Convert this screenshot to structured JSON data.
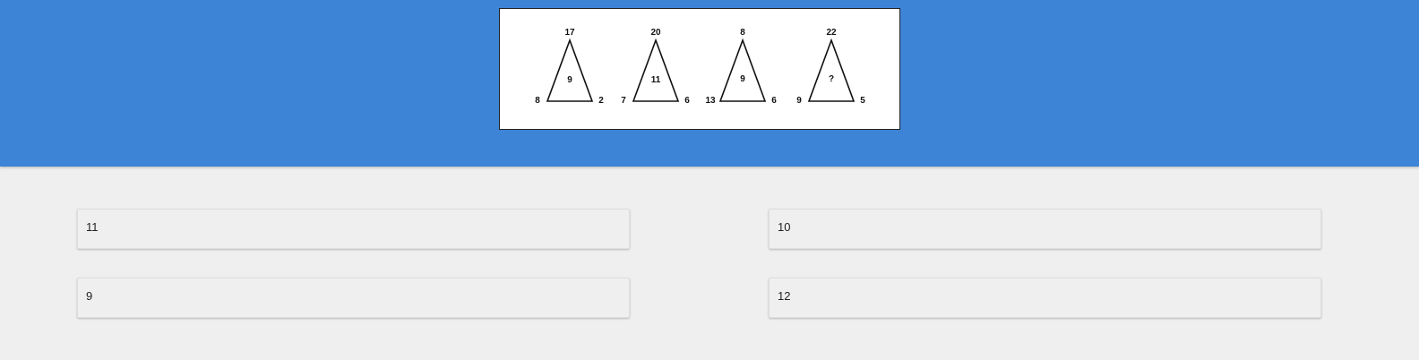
{
  "puzzle": {
    "triangles": [
      {
        "top": "17",
        "left": "8",
        "right": "2",
        "center": "9"
      },
      {
        "top": "20",
        "left": "7",
        "right": "6",
        "center": "11"
      },
      {
        "top": "8",
        "left": "13",
        "right": "6",
        "center": "9"
      },
      {
        "top": "22",
        "left": "9",
        "right": "5",
        "center": "?"
      }
    ]
  },
  "answers": [
    {
      "label": "11"
    },
    {
      "label": "10"
    },
    {
      "label": "9"
    },
    {
      "label": "12"
    }
  ],
  "colors": {
    "header": "#3d84d6",
    "background": "#efefef"
  }
}
